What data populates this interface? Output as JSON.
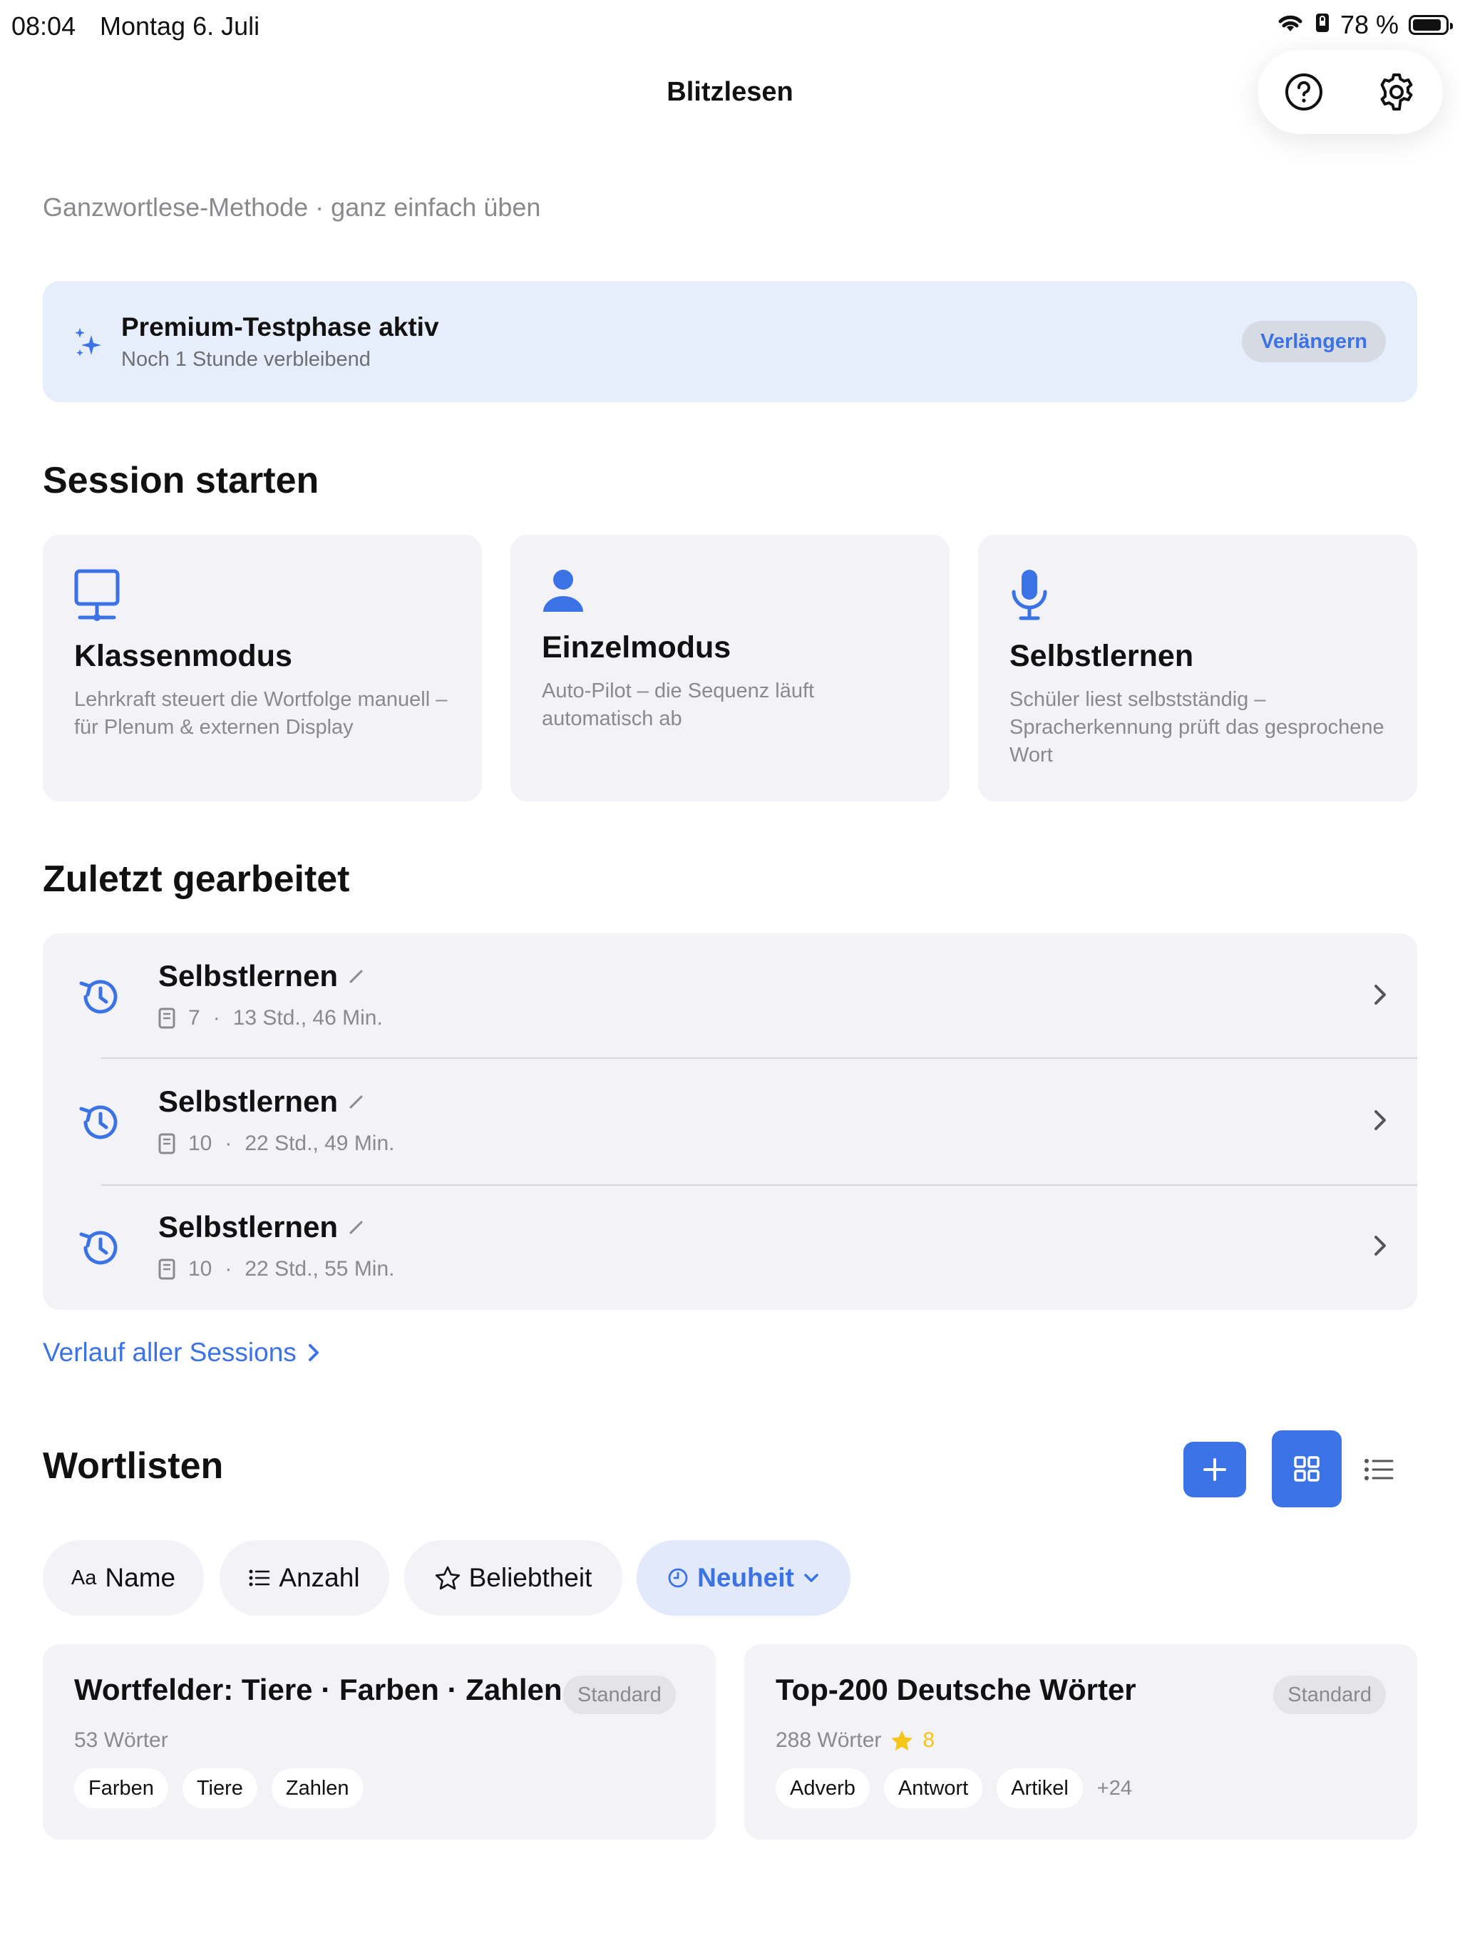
{
  "status_bar": {
    "time": "08:04",
    "date": "Montag 6. Juli",
    "battery": "78 %"
  },
  "nav": {
    "title": "Blitzlesen"
  },
  "subtitle": "Ganzwortlese-Methode · ganz einfach üben",
  "premium": {
    "title": "Premium-Testphase aktiv",
    "subtitle": "Noch 1 Stunde verbleibend",
    "button": "Verlängern"
  },
  "session": {
    "heading": "Session starten",
    "modes": [
      {
        "title": "Klassenmodus",
        "description": "Lehrkraft steuert die Wortfolge manuell – für Plenum & externen Display",
        "icon": "monitor-icon"
      },
      {
        "title": "Einzelmodus",
        "description": "Auto-Pilot – die Sequenz läuft automatisch ab",
        "icon": "person-icon"
      },
      {
        "title": "Selbstlernen",
        "description": "Schüler liest selbstständig – Spracherkennung prüft das gesprochene Wort",
        "icon": "microphone-icon"
      }
    ]
  },
  "recent": {
    "heading": "Zuletzt gearbeitet",
    "items": [
      {
        "title": "Selbstlernen",
        "count": "7",
        "time": "13 Std., 46 Min."
      },
      {
        "title": "Selbstlernen",
        "count": "10",
        "time": "22 Std., 49 Min."
      },
      {
        "title": "Selbstlernen",
        "count": "10",
        "time": "22 Std., 55 Min."
      }
    ],
    "link": "Verlauf aller Sessions"
  },
  "wordlists": {
    "heading": "Wortlisten",
    "sort_chips": [
      {
        "prefix": "Aa",
        "label": "Name"
      },
      {
        "label": "Anzahl"
      },
      {
        "label": "Beliebtheit"
      },
      {
        "label": "Neuheit",
        "active": true
      }
    ],
    "cards": [
      {
        "title": "Wortfelder: Tiere · Farben · Zahlen",
        "badge": "Standard",
        "count": "53 Wörter",
        "tags": [
          "Farben",
          "Tiere",
          "Zahlen"
        ]
      },
      {
        "title": "Top-200 Deutsche Wörter",
        "badge": "Standard",
        "count": "288 Wörter",
        "stars": "8",
        "tags": [
          "Adverb",
          "Antwort",
          "Artikel"
        ],
        "more": "+24"
      }
    ]
  },
  "colors": {
    "accent": "#3b72e5",
    "star": "#f5c518",
    "card": "#f2f2f7",
    "banner": "#e6edfb"
  }
}
